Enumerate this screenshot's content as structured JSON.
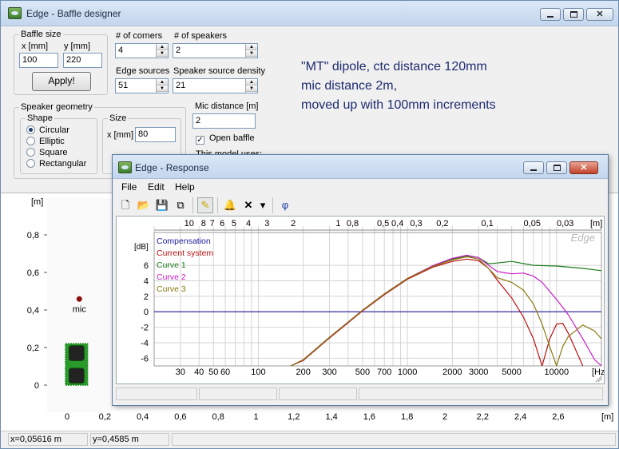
{
  "main_window": {
    "title": "Edge - Baffle designer",
    "baffle_size": {
      "legend": "Baffle size",
      "x_label": "x [mm]",
      "y_label": "y [mm]",
      "x_value": "100",
      "y_value": "220",
      "apply_label": "Apply!"
    },
    "corners": {
      "label": "# of corners",
      "value": "4"
    },
    "speakers": {
      "label": "# of speakers",
      "value": "2"
    },
    "edge_sources": {
      "label": "Edge sources",
      "value": "51"
    },
    "source_density": {
      "label": "Speaker source density",
      "value": "21"
    },
    "mic_distance": {
      "label": "Mic distance [m]",
      "value": "2"
    },
    "open_baffle": {
      "label": "Open baffle",
      "checked": true,
      "mark": "✓"
    },
    "model_uses_label": "This model uses:",
    "speaker_geometry": {
      "legend": "Speaker geometry",
      "shape_legend": "Shape",
      "shapes": [
        {
          "label": "Circular",
          "selected": true
        },
        {
          "label": "Elliptic",
          "selected": false
        },
        {
          "label": "Square",
          "selected": false
        },
        {
          "label": "Rectangular",
          "selected": false
        }
      ],
      "size_legend": "Size",
      "size_label": "x [mm]",
      "size_value": "80"
    },
    "note": [
      "\"MT\" dipole, ctc distance 120mm",
      "mic distance 2m,",
      "moved up with 100mm increments"
    ]
  },
  "geometry_plot": {
    "y_unit": "[m]",
    "x_unit": "[m]",
    "y_ticks": [
      {
        "value": 0,
        "label": "0"
      },
      {
        "value": 0.2,
        "label": "0,2"
      },
      {
        "value": 0.4,
        "label": "0,4"
      },
      {
        "value": 0.6,
        "label": "0,6"
      },
      {
        "value": 0.8,
        "label": "0,8"
      }
    ],
    "x_ticks": [
      {
        "value": 0,
        "label": "0"
      },
      {
        "value": 0.2,
        "label": "0,2"
      },
      {
        "value": 0.4,
        "label": "0,4"
      },
      {
        "value": 0.6,
        "label": "0,6"
      },
      {
        "value": 0.8,
        "label": "0,8"
      },
      {
        "value": 1.0,
        "label": "1"
      },
      {
        "value": 1.2,
        "label": "1,2"
      },
      {
        "value": 1.4,
        "label": "1,4"
      },
      {
        "value": 1.6,
        "label": "1,6"
      },
      {
        "value": 1.8,
        "label": "1,8"
      },
      {
        "value": 2.0,
        "label": "2"
      },
      {
        "value": 2.2,
        "label": "2,2"
      },
      {
        "value": 2.4,
        "label": "2,4"
      },
      {
        "value": 2.6,
        "label": "2,6"
      }
    ],
    "mic_label": "mic",
    "mic_position": {
      "x": 0.05616,
      "y": 0.4585
    },
    "baffle": {
      "width": 0.1,
      "height": 0.22
    },
    "speaker_centers_y": [
      0.05,
      0.17
    ],
    "speaker_diameter": 0.08,
    "colors": {
      "baffle": "#1a8a1a",
      "speaker": "#222222",
      "mic": "#8b1010"
    }
  },
  "status_bar": {
    "x_text": "x=0,05616 m",
    "y_text": "y=0,4585 m"
  },
  "response_window": {
    "title": "Edge - Response",
    "menu": [
      "File",
      "Edit",
      "Help"
    ],
    "toolbar": [
      {
        "name": "new-icon",
        "glyph": "🗋"
      },
      {
        "name": "open-icon",
        "glyph": "📂"
      },
      {
        "name": "save-icon",
        "glyph": "💾"
      },
      {
        "name": "copy-icon",
        "glyph": "⧉"
      },
      {
        "name": "pen-icon",
        "glyph": "✎"
      },
      {
        "name": "bell-icon",
        "glyph": "🔔"
      },
      {
        "name": "delete-icon",
        "glyph": "✕"
      },
      {
        "name": "dropdown-icon",
        "glyph": "▾"
      },
      {
        "name": "phase-icon",
        "glyph": "φ"
      }
    ],
    "watermark": "Edge"
  },
  "chart_data": {
    "type": "line",
    "ylabel": "[dB]",
    "xlabel": "[Hz]",
    "top_axis_label": "[m]",
    "xscale": "log",
    "xlim": [
      20,
      20000
    ],
    "ylim": [
      -7,
      9
    ],
    "grid": true,
    "legend_position": "top-left",
    "y_ticks": [
      6,
      4,
      2,
      0,
      -2,
      -4,
      -6
    ],
    "x_ticks": [
      {
        "value": 30,
        "label": "30"
      },
      {
        "value": 40,
        "label": "40"
      },
      {
        "value": 50,
        "label": "50"
      },
      {
        "value": 60,
        "label": "60"
      },
      {
        "value": 100,
        "label": "100"
      },
      {
        "value": 200,
        "label": "200"
      },
      {
        "value": 300,
        "label": "300"
      },
      {
        "value": 500,
        "label": "500"
      },
      {
        "value": 700,
        "label": "700"
      },
      {
        "value": 1000,
        "label": "1000"
      },
      {
        "value": 2000,
        "label": "2000"
      },
      {
        "value": 3000,
        "label": "3000"
      },
      {
        "value": 5000,
        "label": "5000"
      },
      {
        "value": 10000,
        "label": "10000"
      }
    ],
    "top_ticks": [
      {
        "value": 10,
        "label": "10"
      },
      {
        "value": 8,
        "label": "8"
      },
      {
        "value": 7,
        "label": "7"
      },
      {
        "value": 6,
        "label": "6"
      },
      {
        "value": 5,
        "label": "5"
      },
      {
        "value": 4,
        "label": "4"
      },
      {
        "value": 3,
        "label": "3"
      },
      {
        "value": 2,
        "label": "2"
      },
      {
        "value": 1,
        "label": "1"
      },
      {
        "value": 0.8,
        "label": "0,8"
      },
      {
        "value": 0.5,
        "label": "0,5"
      },
      {
        "value": 0.4,
        "label": "0,4"
      },
      {
        "value": 0.3,
        "label": "0,3"
      },
      {
        "value": 0.2,
        "label": "0,2"
      },
      {
        "value": 0.1,
        "label": "0,1"
      },
      {
        "value": 0.05,
        "label": "0,05"
      },
      {
        "value": 0.03,
        "label": "0,03"
      }
    ],
    "series": [
      {
        "name": "Compensation",
        "color": "#1c1c9c",
        "x": [
          20,
          20000
        ],
        "y": [
          0,
          0
        ]
      },
      {
        "name": "Current system",
        "color": "#c01010",
        "x": [
          165,
          200,
          300,
          500,
          700,
          1000,
          1500,
          2000,
          2500,
          3000,
          3500,
          4000,
          5000,
          6000,
          7000,
          8000,
          9000,
          10000,
          11000,
          12000,
          15000
        ],
        "y": [
          -7,
          -6.3,
          -3.4,
          0.1,
          2.2,
          4.2,
          5.8,
          6.5,
          6.8,
          6.6,
          5.6,
          4.1,
          1.8,
          -0.7,
          -3.5,
          -7,
          -3.5,
          -1.6,
          -1.5,
          -2.8,
          -7
        ]
      },
      {
        "name": "Curve 1",
        "color": "#1a7a1a",
        "x": [
          165,
          200,
          300,
          500,
          700,
          1000,
          1500,
          2000,
          2500,
          3000,
          3500,
          4000,
          5000,
          7000,
          10000,
          15000,
          20000
        ],
        "y": [
          -7,
          -6.2,
          -3.3,
          0.2,
          2.3,
          4.3,
          6.0,
          6.8,
          7.2,
          7.0,
          6.2,
          6.3,
          6.5,
          6.0,
          5.9,
          5.6,
          5.3
        ]
      },
      {
        "name": "Curve 2",
        "color": "#c81ec8",
        "x": [
          165,
          200,
          300,
          500,
          700,
          1000,
          1500,
          2000,
          2500,
          3000,
          3500,
          4000,
          5000,
          6000,
          7000,
          8000,
          10000,
          12000,
          15000,
          18000,
          20000
        ],
        "y": [
          -7,
          -6.2,
          -3.3,
          0.2,
          2.3,
          4.3,
          6.0,
          6.9,
          7.3,
          7.0,
          6.0,
          5.2,
          4.9,
          5.0,
          4.6,
          3.8,
          1.6,
          -0.4,
          -3.5,
          -6.2,
          -7
        ]
      },
      {
        "name": "Curve 3",
        "color": "#8a7a10",
        "x": [
          165,
          200,
          300,
          500,
          700,
          1000,
          1500,
          2000,
          2500,
          3000,
          3500,
          4000,
          5000,
          6000,
          7000,
          8000,
          9000,
          10000,
          11000,
          12000,
          15000,
          18000,
          20000
        ],
        "y": [
          -7,
          -6.2,
          -3.3,
          0.2,
          2.3,
          4.3,
          5.9,
          6.7,
          7.1,
          6.8,
          5.6,
          4.4,
          3.8,
          2.8,
          1.0,
          -1.6,
          -4.5,
          -7,
          -4.5,
          -3.2,
          -1.7,
          -2.5,
          -3.5
        ]
      }
    ]
  }
}
